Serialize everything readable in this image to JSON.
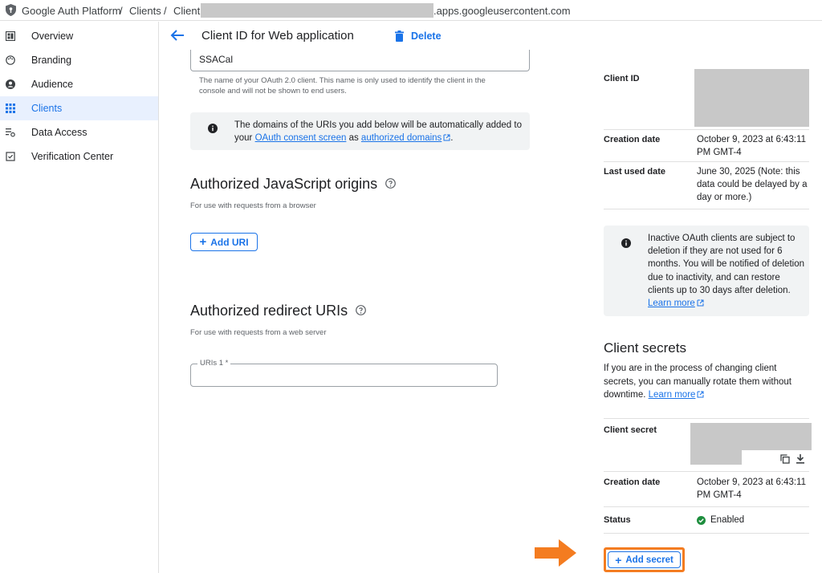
{
  "breadcrumb": {
    "platform": "Google Auth Platform",
    "sep1": "/",
    "clients": "Clients",
    "sep2": "/",
    "client_prefix": "Client",
    "client_suffix": ".apps.googleusercontent.com"
  },
  "sidebar": {
    "items": [
      {
        "label": "Overview",
        "icon": "dashboard-icon"
      },
      {
        "label": "Branding",
        "icon": "palette-icon"
      },
      {
        "label": "Audience",
        "icon": "account-circle-icon"
      },
      {
        "label": "Clients",
        "icon": "grid-icon",
        "active": true
      },
      {
        "label": "Data Access",
        "icon": "data-settings-icon"
      },
      {
        "label": "Verification Center",
        "icon": "checkbox-icon"
      }
    ]
  },
  "header": {
    "title": "Client ID for Web application",
    "delete_label": "Delete"
  },
  "form": {
    "name_value": "SSACal",
    "name_hint": "The name of your OAuth 2.0 client. This name is only used to identify the client in the console and will not be shown to end users.",
    "info": {
      "text_before": "The domains of the URIs you add below will be automatically added to your ",
      "link1": "OAuth consent screen",
      "text_mid": " as ",
      "link2": "authorized domains",
      "text_after": "."
    },
    "js_origins": {
      "title": "Authorized JavaScript origins",
      "subtitle": "For use with requests from a browser",
      "add_label": "Add URI"
    },
    "redirect_uris": {
      "title": "Authorized redirect URIs",
      "subtitle": "For use with requests from a web server",
      "field_label": "URIs 1 *"
    }
  },
  "details": {
    "client_id_label": "Client ID",
    "creation_date_label": "Creation date",
    "creation_date_value": "October 9, 2023 at 6:43:11 PM GMT-4",
    "last_used_label": "Last used date",
    "last_used_value": "June 30, 2025 (Note: this data could be delayed by a day or more.)",
    "inactive_notice": {
      "text": "Inactive OAuth clients are subject to deletion if they are not used for 6 months. You will be notified of deletion due to inactivity, and can restore clients up to 30 days after deletion. ",
      "link": "Learn more"
    }
  },
  "secrets": {
    "title": "Client secrets",
    "desc": "If you are in the process of changing client secrets, you can manually rotate them without downtime. ",
    "desc_link": "Learn more",
    "secret_label": "Client secret",
    "creation_date_label": "Creation date",
    "creation_date_value": "October 9, 2023 at 6:43:11 PM GMT-4",
    "status_label": "Status",
    "status_value": "Enabled",
    "add_label": "Add secret"
  },
  "colors": {
    "accent": "#1a73e8",
    "annotation": "#f47c20",
    "enabled": "#1e8e3e"
  }
}
